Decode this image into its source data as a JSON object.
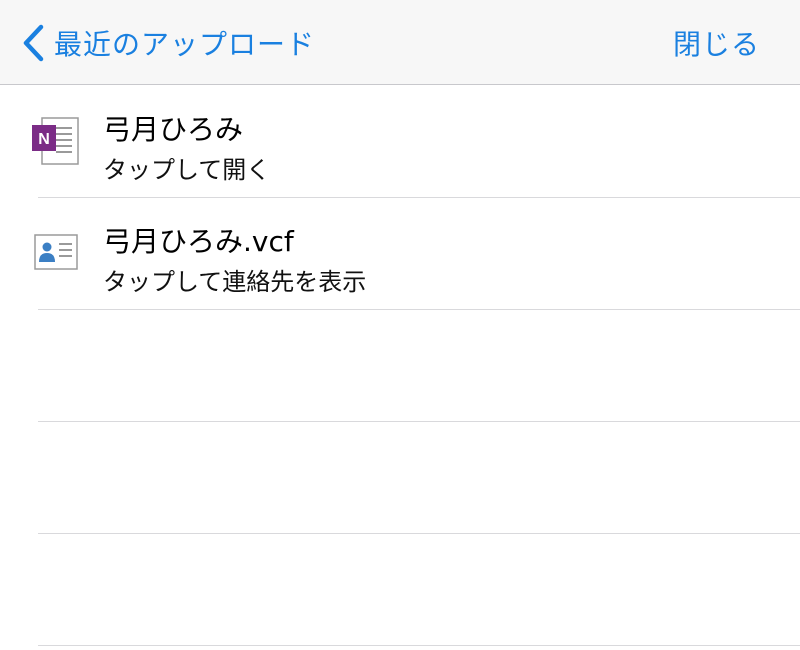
{
  "navbar": {
    "back_label": "最近のアップロード",
    "close_label": "閉じる",
    "accent_color": "#1a80e0"
  },
  "files": [
    {
      "name": "弓月ひろみ",
      "action": "タップして開く",
      "icon": "onenote-icon"
    },
    {
      "name": "弓月ひろみ.vcf",
      "action": "タップして連絡先を表示",
      "icon": "contact-card-icon"
    }
  ]
}
